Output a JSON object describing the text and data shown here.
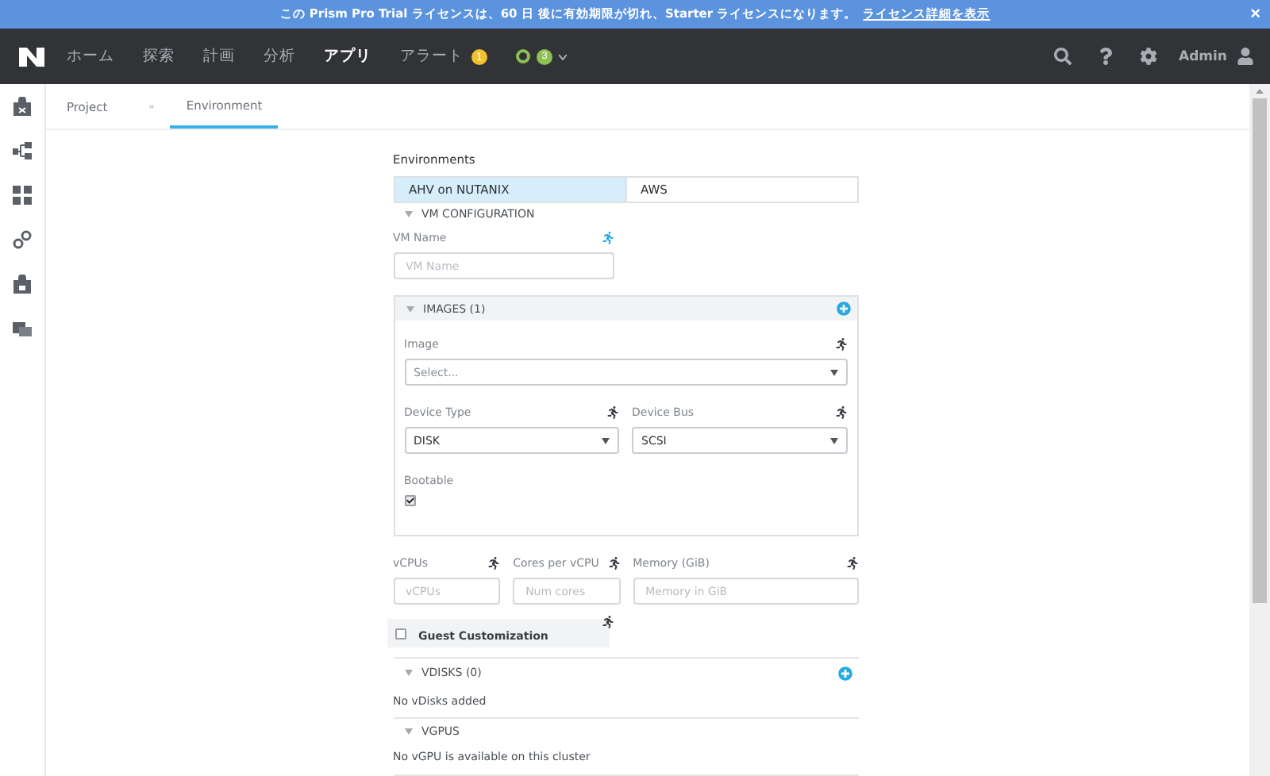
{
  "banner": {
    "message": "この Prism Pro Trial ライセンスは、60 日 後に有効期限が切れ、Starter ライセンスになります。",
    "link": "ライセンス詳細を表示",
    "close": "×"
  },
  "nav": {
    "items": [
      {
        "label": "ホーム",
        "selected": false
      },
      {
        "label": "探索",
        "selected": false
      },
      {
        "label": "計画",
        "selected": false
      },
      {
        "label": "分析",
        "selected": false
      },
      {
        "label": "アプリ",
        "selected": true
      },
      {
        "label": "アラート",
        "selected": false,
        "badge": "1"
      }
    ],
    "health_count": "3",
    "user": "Admin"
  },
  "breadcrumb_separator": "»",
  "breadcrumb": [
    {
      "label": "Project",
      "selected": false
    },
    {
      "label": "Environment",
      "selected": true
    }
  ],
  "form": {
    "title": "Environments",
    "env_tabs": [
      {
        "label": "AHV on NUTANIX",
        "selected": true
      },
      {
        "label": "AWS",
        "selected": false
      }
    ],
    "vm_section": "VM CONFIGURATION",
    "vm_name": {
      "label": "VM Name",
      "placeholder": "VM Name"
    },
    "images": {
      "title": "IMAGES (1)",
      "image": {
        "label": "Image",
        "placeholder": "Select..."
      },
      "device_type": {
        "label": "Device Type",
        "value": "DISK"
      },
      "device_bus": {
        "label": "Device Bus",
        "value": "SCSI"
      },
      "bootable": {
        "label": "Bootable",
        "checked": true
      }
    },
    "resources": [
      {
        "label": "vCPUs",
        "placeholder": "vCPUs"
      },
      {
        "label": "Cores per vCPU",
        "placeholder": "Num cores"
      },
      {
        "label": "Memory (GiB)",
        "placeholder": "Memory in GiB"
      }
    ],
    "guest_customization": {
      "label": "Guest Customization",
      "checked": false
    },
    "vdisks": {
      "title": "VDISKS (0)",
      "empty": "No vDisks added"
    },
    "vgpus": {
      "title": "VGPUS",
      "empty": "No vGPU is available on this cluster"
    }
  }
}
